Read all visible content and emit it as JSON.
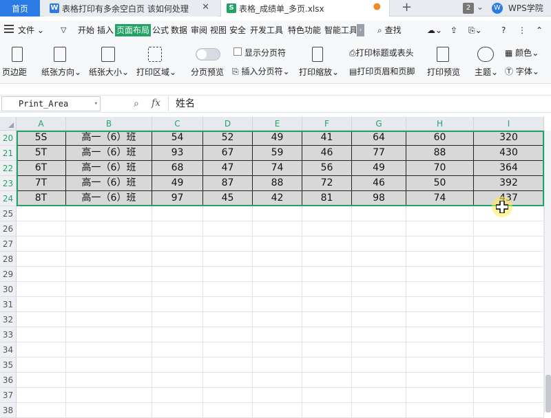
{
  "tabs": {
    "home": "首页",
    "doc": "表格打印有多余空白页 该如何处理",
    "file": "表格_成绩单_多页.xlsx",
    "counter": "2",
    "brand": "WPS学院"
  },
  "menu": {
    "file": "文件",
    "items": [
      "开始",
      "插入",
      "页面布局",
      "公式",
      "数据",
      "审阅",
      "视图",
      "安全",
      "开发工具",
      "特色功能",
      "智能工具"
    ],
    "active": "页面布局",
    "find": "查找"
  },
  "ribbon": {
    "margins": "页边距",
    "orientation": "纸张方向",
    "size": "纸张大小",
    "print_area": "打印区域",
    "page_break_preview": "分页预览",
    "show_page_breaks": "显示分页符",
    "insert_page_break": "插入分页符",
    "print_scale": "打印缩放",
    "print_titles": "打印标题或表头",
    "print_header_footer": "打印页眉和页脚",
    "print_preview": "打印预览",
    "theme": "主题",
    "colors": "颜色",
    "fonts": "字体"
  },
  "formula": {
    "name_box": "Print_Area",
    "fx": "fx",
    "value": "姓名"
  },
  "columns": [
    "A",
    "B",
    "C",
    "D",
    "E",
    "F",
    "G",
    "H",
    "I"
  ],
  "data_rows": [
    {
      "row": "20",
      "cells": [
        "5S",
        "高一（6）班",
        "54",
        "52",
        "49",
        "41",
        "64",
        "60",
        "320"
      ]
    },
    {
      "row": "21",
      "cells": [
        "5T",
        "高一（6）班",
        "93",
        "67",
        "59",
        "46",
        "77",
        "88",
        "430"
      ]
    },
    {
      "row": "22",
      "cells": [
        "6T",
        "高一（6）班",
        "68",
        "47",
        "74",
        "56",
        "49",
        "70",
        "364"
      ]
    },
    {
      "row": "23",
      "cells": [
        "7T",
        "高一（6）班",
        "49",
        "87",
        "88",
        "72",
        "46",
        "50",
        "392"
      ]
    },
    {
      "row": "24",
      "cells": [
        "8T",
        "高一（6）班",
        "97",
        "45",
        "42",
        "81",
        "98",
        "74",
        "437"
      ]
    }
  ],
  "empty_rows": [
    "25",
    "26",
    "27",
    "28",
    "29",
    "30",
    "31",
    "32",
    "33",
    "34",
    "35",
    "36",
    "37",
    "38"
  ],
  "colors": {
    "accent": "#21a366",
    "tab_blue": "#2c7be5",
    "selected_fill": "#d8d8d8"
  }
}
